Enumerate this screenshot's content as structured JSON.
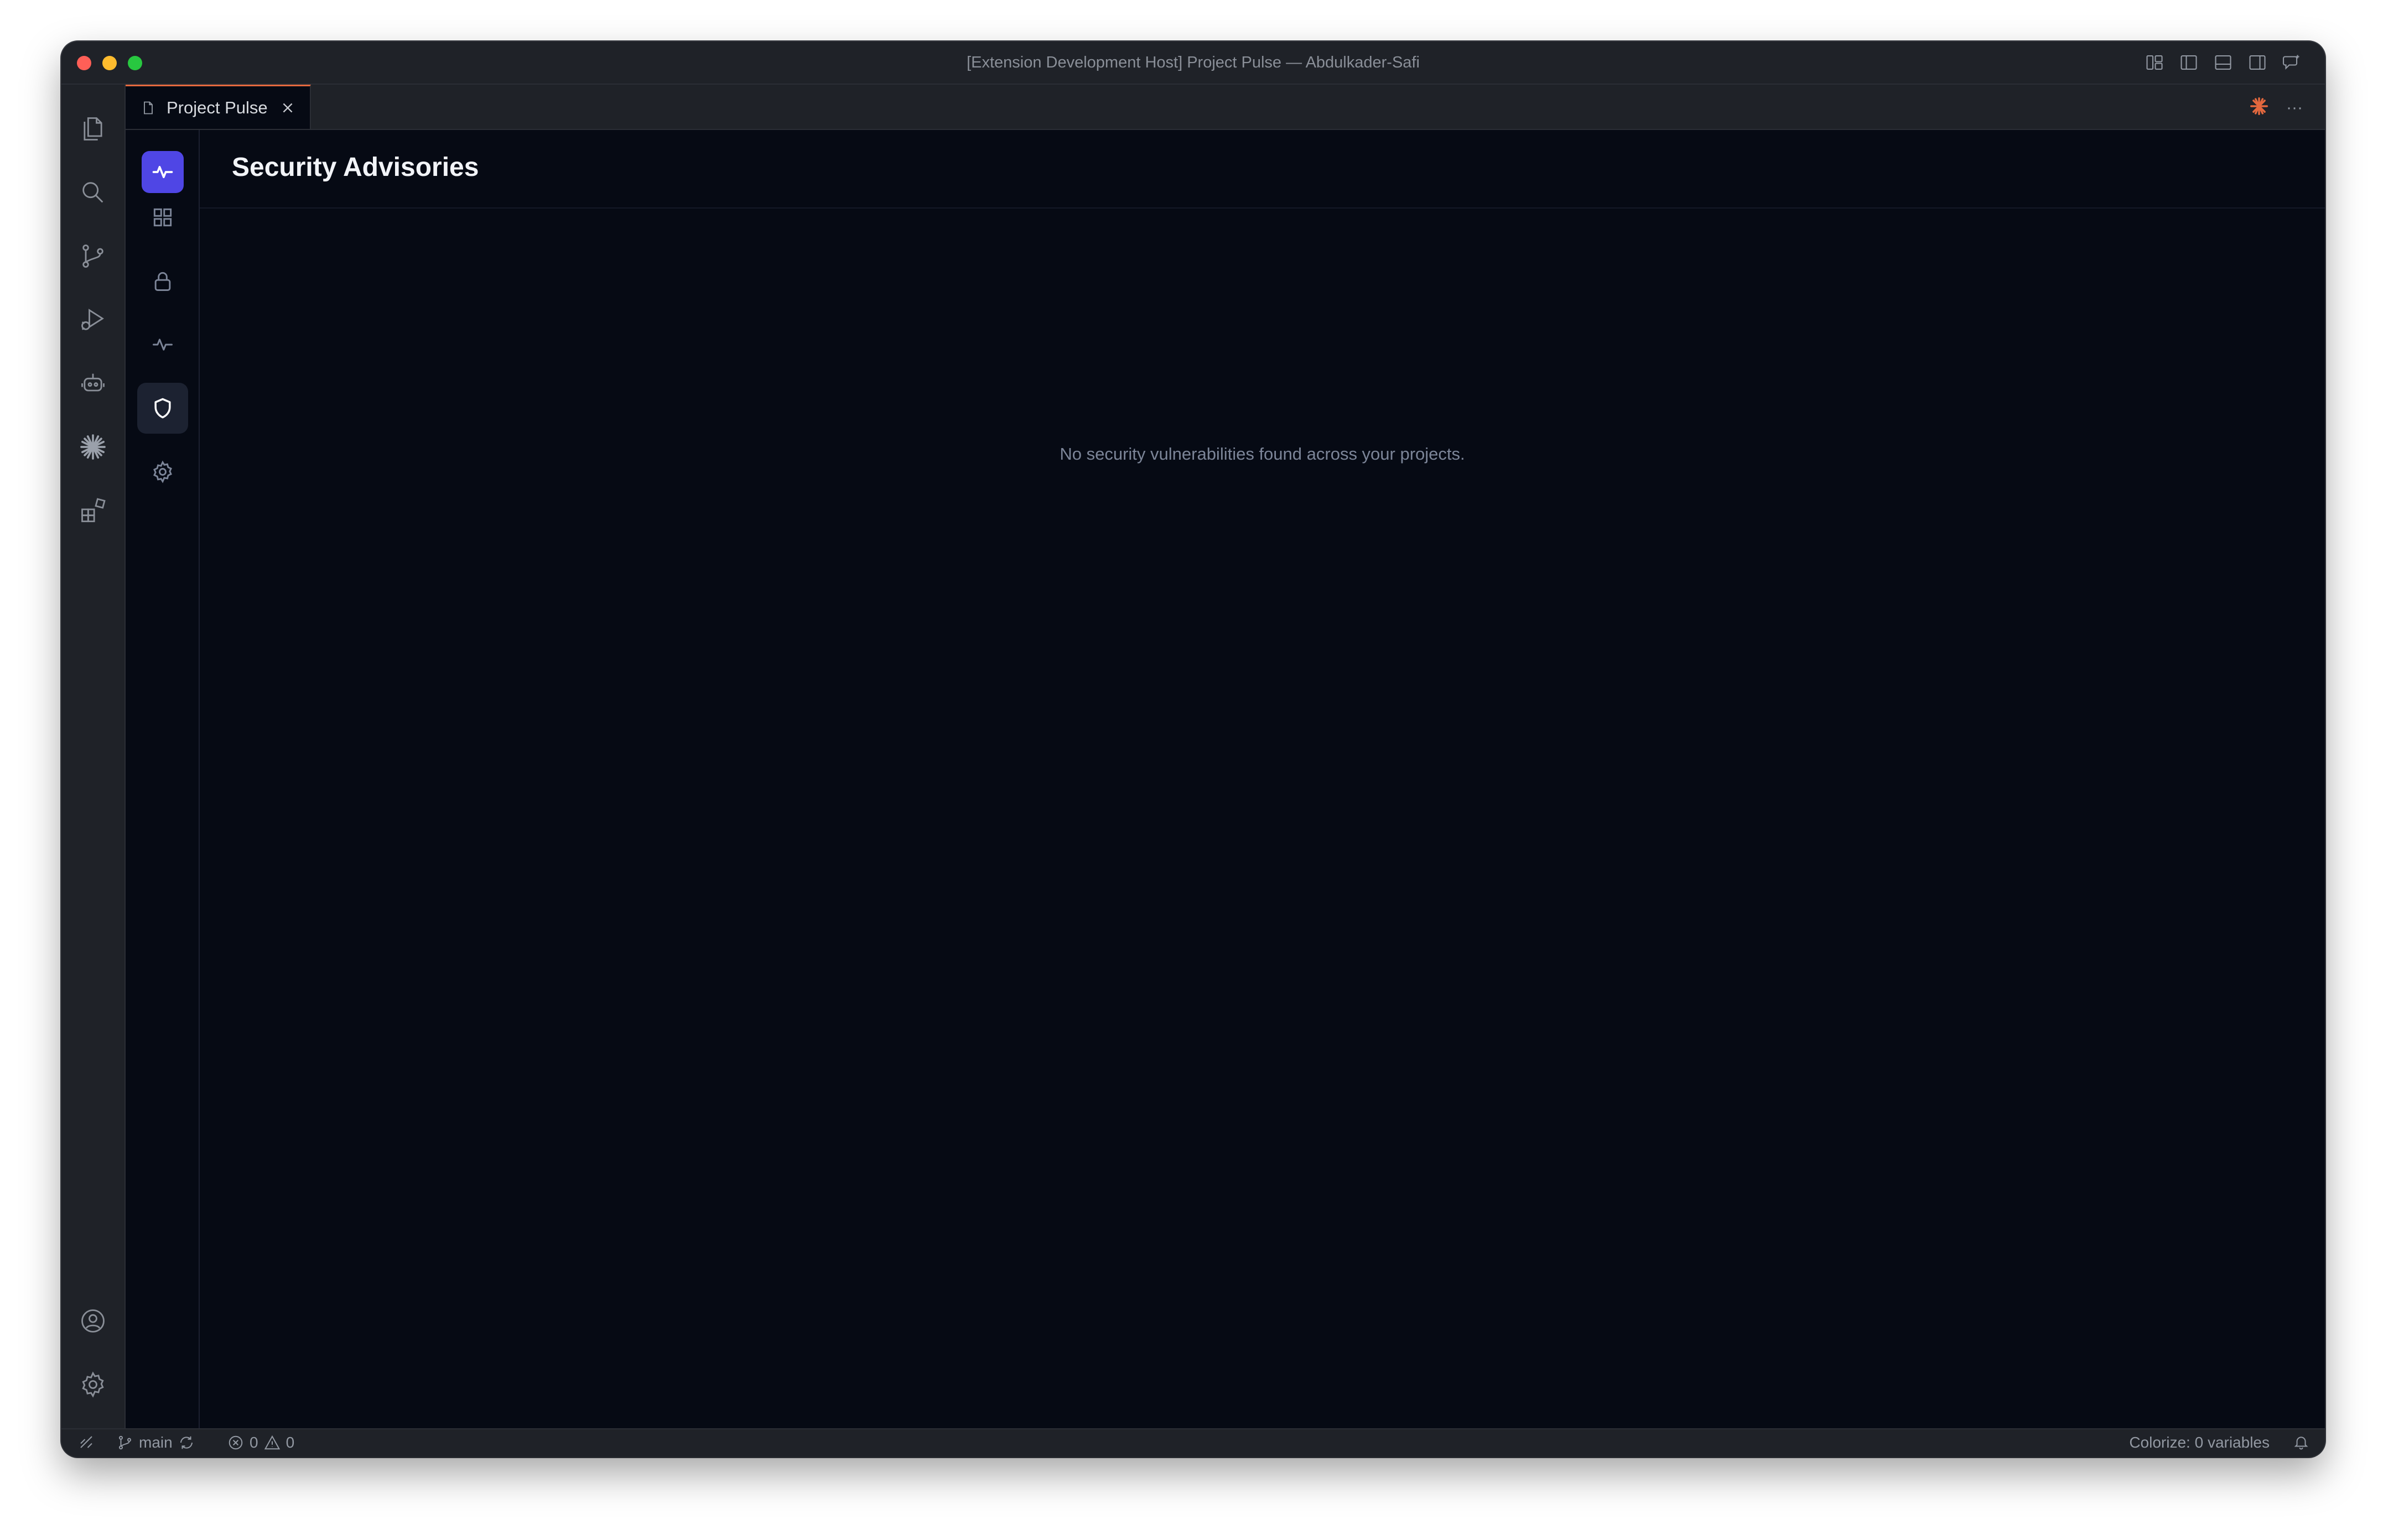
{
  "window": {
    "title": "[Extension Development Host] Project Pulse — Abdulkader-Safi"
  },
  "title_actions": [
    "layout-icon",
    "toggle-primary-sidebar-icon",
    "toggle-panel-icon",
    "toggle-secondary-sidebar-icon",
    "chat-icon"
  ],
  "activity_bar": {
    "top": [
      "explorer-icon",
      "search-icon",
      "source-control-icon",
      "run-debug-icon",
      "copilot-icon",
      "claude-icon",
      "extensions-icon"
    ],
    "bottom": [
      "accounts-icon",
      "manage-gear-icon"
    ]
  },
  "tab": {
    "label": "Project Pulse"
  },
  "tab_actions": [
    "claude-icon",
    "more-actions-icon"
  ],
  "more_actions_glyph": "···",
  "ext_sidebar": {
    "items": [
      "dashboard-icon",
      "lock-icon",
      "activity-icon",
      "shield-icon",
      "settings-icon"
    ],
    "active": "shield-icon"
  },
  "main": {
    "title": "Security Advisories",
    "empty_message": "No security vulnerabilities found across your projects."
  },
  "status": {
    "branch": "main",
    "errors": "0",
    "warnings": "0",
    "colorize": "Colorize: 0 variables"
  },
  "colors": {
    "accent": "#4f46e5",
    "tab_border": "#e3683e",
    "claude": "#e3683e",
    "background": "#060a14"
  }
}
